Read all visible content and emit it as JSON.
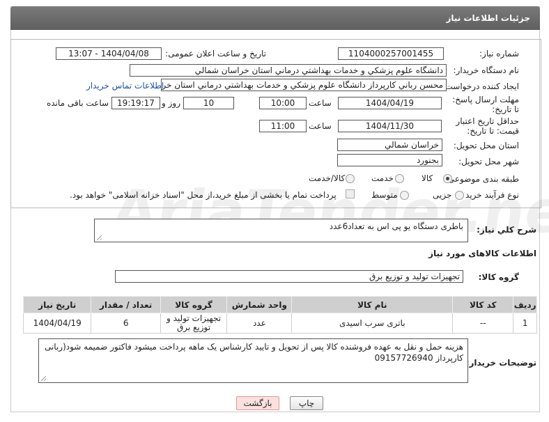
{
  "header": {
    "title": "جزئیات اطلاعات نیاز"
  },
  "form": {
    "need_number_label": "شماره نیاز:",
    "need_number": "1104000257001455",
    "announce_label": "تاریخ و ساعت اعلان عمومی:",
    "announce_value": "1404/04/08 - 13:07",
    "buyer_org_label": "نام دستگاه خریدار:",
    "buyer_org": "دانشگاه علوم پزشکي و خدمات بهداشتي درماني استان خراسان شمالي",
    "requester_label": "ایجاد کننده درخواست:",
    "requester": "محسن رباني کارپرداز دانشگاه علوم پزشکي و خدمات بهداشتي درماني استان خراسان شمالي",
    "contact_link": "اطلاعات تماس خریدار",
    "deadline_label": "مهلت ارسال پاسخ: تا تاریخ:",
    "deadline_date": "1404/04/19",
    "time_label": "ساعت",
    "deadline_time": "10:00",
    "days": "10",
    "days_label": "روز و",
    "remaining_time": "19:19:17",
    "remaining_label": "ساعت باقی مانده",
    "validity_label": "حداقل تاریخ اعتبار قیمت: تا تاریخ:",
    "validity_date": "1404/11/30",
    "validity_time": "11:00",
    "province_label": "استان محل تحویل:",
    "province": "خراسان شمالي",
    "city_label": "شهر محل تحویل:",
    "city": "بجنورد",
    "category_label": "طبقه بندی موضوعی:",
    "category_options": [
      "کالا",
      "خدمت",
      "کالا/خدمت"
    ],
    "category_selected": "کالا",
    "process_label": "نوع فرآیند خرید :",
    "process_options": [
      "جزیی",
      "متوسط"
    ],
    "process_note": "پرداخت تمام یا بخشی از مبلغ خرید،از محل \"اسناد خزانه اسلامی\" خواهد بود."
  },
  "description": {
    "label": "شرح کلي نياز:",
    "text": "باطری دستگاه یو پی اس به تعداد6عدد"
  },
  "goods": {
    "section_title": "اطلاعات کالاهای مورد نیاز",
    "group_label": "گروه کالا:",
    "group_value": "تجهیزات تولید و توزیع برق",
    "columns": [
      "ردیف",
      "کد کالا",
      "نام کالا",
      "واحد شمارش",
      "گروه کالا",
      "تعداد / مقدار",
      "تاریخ نیاز"
    ],
    "rows": [
      {
        "row": "1",
        "code": "--",
        "name": "باتری سرب اسیدی",
        "unit": "عدد",
        "group": "تجهیزات تولید و توزیع برق",
        "qty": "6",
        "date": "1404/04/19"
      }
    ]
  },
  "buyer_notes": {
    "label": "توضیحات خریدار:",
    "text": "هزینه حمل و نقل به عهده فروشنده کالا پس از تحویل و تایید کارشناس یک ماهه پرداخت میشود فاکتور ضمیمه شود(ربانی کارپرداز 09157726940"
  },
  "buttons": {
    "print": "چاپ",
    "back": "بازگشت"
  },
  "watermark": "AriaTender.net",
  "colors": {
    "header_bg": "#6b6b6b",
    "link": "#1a4fb5",
    "table_header": "#cfcfcf",
    "back_button": "#fbe0e0"
  }
}
